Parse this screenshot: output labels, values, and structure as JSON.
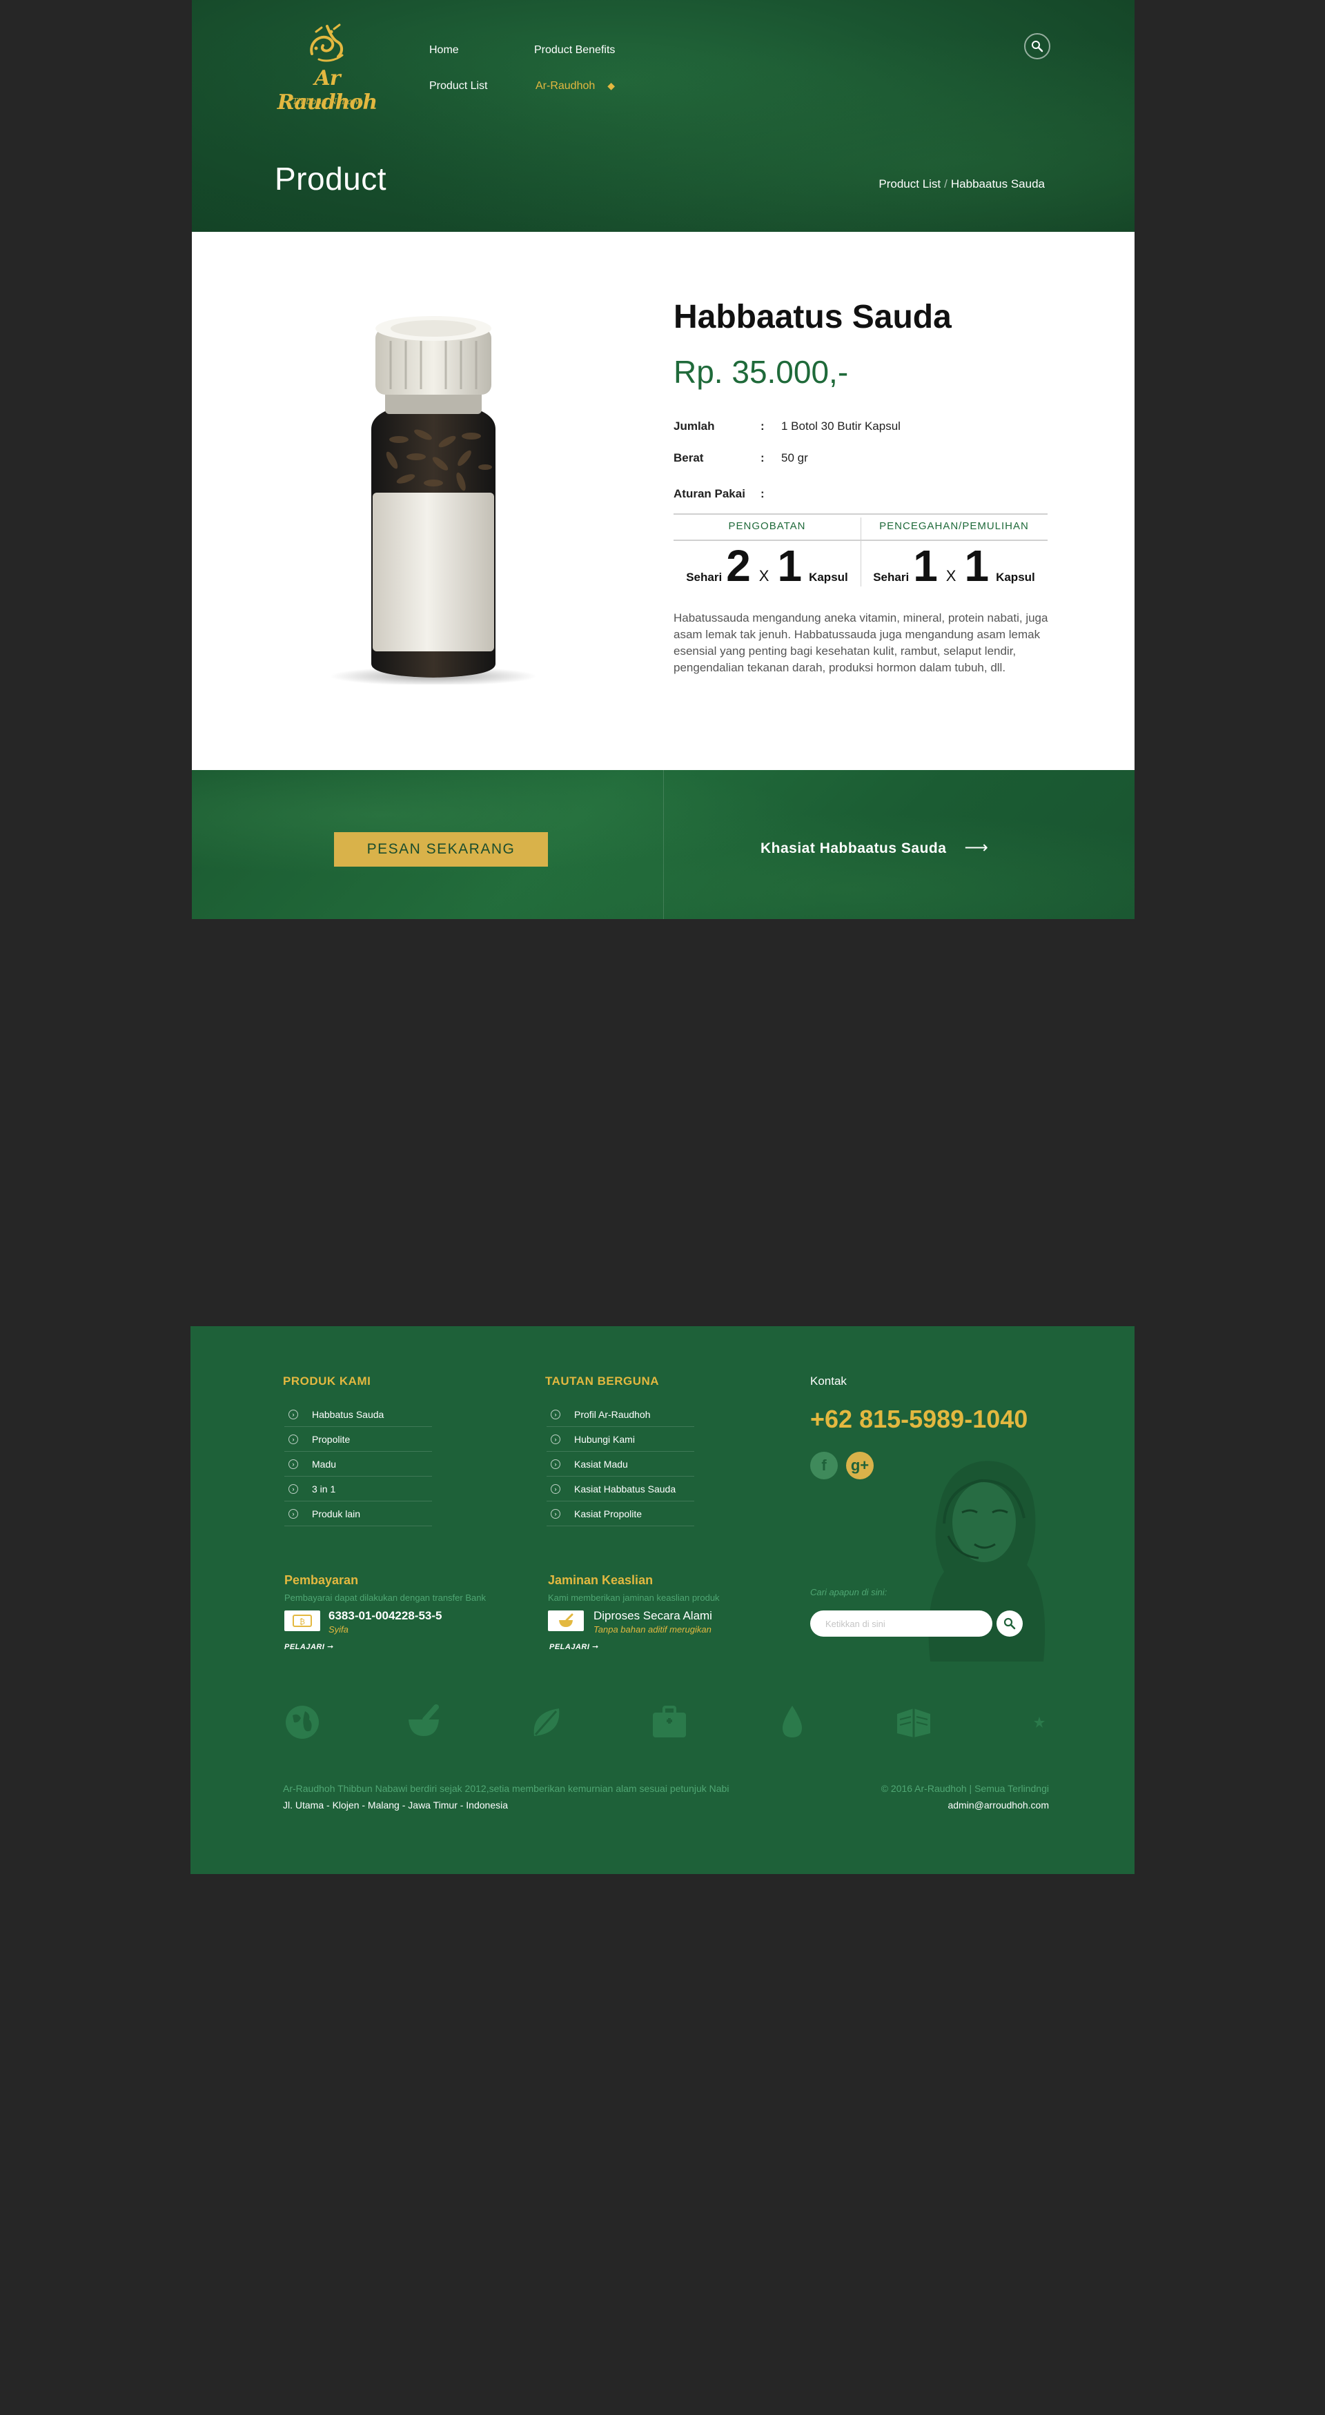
{
  "brand": {
    "name": "Ar Raudhoh",
    "tagline": "Thibbun Nabawi"
  },
  "nav": {
    "home": "Home",
    "product_benefits": "Product Benefits",
    "product_list": "Product List",
    "active_item": "Ar-Raudhoh"
  },
  "page": {
    "title": "Product"
  },
  "breadcrumb": {
    "parent": "Product List",
    "separator": "/",
    "current": "Habbaatus Sauda"
  },
  "product": {
    "name": "Habbaatus Sauda",
    "price": "Rp. 35.000,-",
    "specs": {
      "jumlah_label": "Jumlah",
      "jumlah_value": "1 Botol 30 Butir Kapsul",
      "berat_label": "Berat",
      "berat_value": "50 gr",
      "aturan_label": "Aturan Pakai",
      "colon": ":"
    },
    "dosage": {
      "col1_header": "PENGOBATAN",
      "col2_header": "PENCEGAHAN/PEMULIHAN",
      "per_day": "Sehari",
      "times": "X",
      "unit": "Kapsul",
      "col1_freq": "2",
      "col1_qty": "1",
      "col2_freq": "1",
      "col2_qty": "1"
    },
    "description": "Habatussauda mengandung aneka vitamin, mineral, protein nabati, juga asam lemak tak jenuh. Habbatussauda juga mengandung asam lemak esensial yang penting bagi kesehatan kulit, rambut, selaput lendir, pengendalian tekanan darah, produksi hormon dalam tubuh, dll."
  },
  "cta": {
    "order_label": "PESAN SEKARANG",
    "benefit_label": "Khasiat Habbaatus Sauda",
    "arrow": "⟶"
  },
  "footer": {
    "produk": {
      "title": "PRODUK KAMI",
      "items": [
        "Habbatus Sauda",
        "Propolite",
        "Madu",
        "3 in 1",
        "Produk lain"
      ]
    },
    "tautan": {
      "title": "TAUTAN BERGUNA",
      "items": [
        "Profil Ar-Raudhoh",
        "Hubungi Kami",
        "Kasiat Madu",
        "Kasiat Habbatus Sauda",
        "Kasiat Propolite"
      ]
    },
    "kontak": {
      "label": "Kontak",
      "phone": "+62 815-5989-1040",
      "fb": "f",
      "gplus": "g+"
    },
    "pembayaran": {
      "title": "Pembayaran",
      "subtitle": "Pembayarai dapat dilakukan dengan transfer Bank",
      "account": "6383-01-004228-53-5",
      "holder": "Syifa",
      "learn": "PELAJARI ➞"
    },
    "jaminan": {
      "title": "Jaminan Keaslian",
      "subtitle": "Kami memberikan jaminan keaslian produk",
      "main": "Diproses Secara Alami",
      "note": "Tanpa bahan aditif merugikan",
      "learn": "PELAJARI ➞"
    },
    "search": {
      "hint": "Cari apapun di sini:",
      "placeholder": "Ketikkan di sini"
    },
    "about": "Ar-Raudhoh Thibbun Nabawi berdiri sejak 2012,setia memberikan kemurnian alam sesuai petunjuk Nabi",
    "address": "Jl. Utama - Klojen - Malang - Jawa Timur - Indonesia",
    "copyright": "© 2016 Ar-Raudhoh | Semua Terlindngi",
    "email": "admin@arroudhoh.com"
  },
  "colors": {
    "green": "#1e6139",
    "gold": "#e3b840",
    "dark_bg": "#262626"
  },
  "icons": [
    "globe-icon",
    "mortar-pestle-icon",
    "leaf-icon",
    "medical-kit-icon",
    "drop-icon",
    "quran-icon",
    "crescent-star-icon"
  ]
}
